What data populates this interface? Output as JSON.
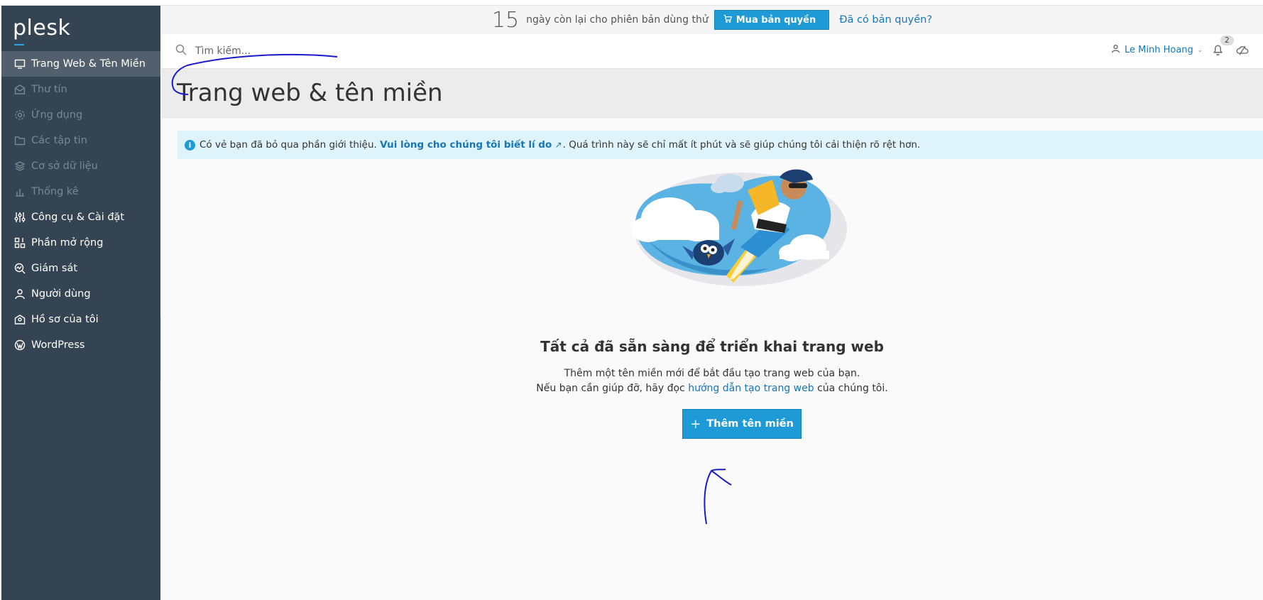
{
  "logo": "plesk",
  "sidebar": {
    "items": [
      {
        "label": "Trang Web & Tên Miền",
        "icon": "monitor-icon",
        "state": "active"
      },
      {
        "label": "Thư tín",
        "icon": "mail-icon",
        "state": "disabled"
      },
      {
        "label": "Ứng dụng",
        "icon": "gear-icon",
        "state": "disabled"
      },
      {
        "label": "Các tập tin",
        "icon": "folder-icon",
        "state": "disabled"
      },
      {
        "label": "Cơ sở dữ liệu",
        "icon": "database-icon",
        "state": "disabled"
      },
      {
        "label": "Thống kê",
        "icon": "bar-chart-icon",
        "state": "disabled"
      },
      {
        "label": "Công cụ & Cài đặt",
        "icon": "sliders-icon",
        "state": "normal"
      },
      {
        "label": "Phần mở rộng",
        "icon": "extensions-icon",
        "state": "normal"
      },
      {
        "label": "Giám sát",
        "icon": "monitoring-icon",
        "state": "normal"
      },
      {
        "label": "Người dùng",
        "icon": "user-icon",
        "state": "normal"
      },
      {
        "label": "Hồ sơ của tôi",
        "icon": "profile-icon",
        "state": "normal"
      },
      {
        "label": "WordPress",
        "icon": "wordpress-icon",
        "state": "normal"
      }
    ]
  },
  "trial": {
    "days": "15",
    "text": "ngày còn lại cho phiên bản dùng thử",
    "buy_label": "Mua bản quyền",
    "have_license_label": "Đã có bản quyền?"
  },
  "search": {
    "placeholder": "Tìm kiếm..."
  },
  "user": {
    "name": "Le Minh Hoang",
    "notification_count": "2"
  },
  "page": {
    "title": "Trang web & tên miền"
  },
  "info": {
    "prefix": "Có vẻ bạn đã bỏ qua phần giới thiệu.",
    "link": "Vui lòng cho chúng tôi biết lí do",
    "suffix": ". Quá trình này sẽ chỉ mất ít phút và sẽ giúp chúng tôi cải thiện rõ rệt hơn."
  },
  "empty_state": {
    "title": "Tất cả đã sẵn sàng để triển khai trang web",
    "line1": "Thêm một tên miền mới để bắt đầu tạo trang web của bạn.",
    "line2_prefix": "Nếu bạn cần giúp đỡ, hãy đọc",
    "line2_link": "hướng dẫn tạo trang web",
    "line2_suffix": "của chúng tôi.",
    "add_button": "Thêm tên miền"
  },
  "colors": {
    "sidebar": "#354452",
    "accent": "#1e9bd7",
    "link": "#1676b6",
    "annotation": "#1a1acc"
  }
}
